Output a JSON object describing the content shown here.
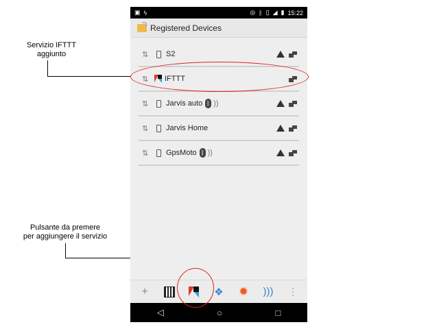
{
  "status_bar": {
    "time": "15:22",
    "left_icons": [
      "sim-icon",
      "charging-icon"
    ],
    "right_icons": [
      "nfc-icon",
      "bluetooth-icon",
      "vibrate-icon",
      "signal-icon",
      "battery-icon"
    ]
  },
  "app_bar": {
    "title": "Registered Devices"
  },
  "devices": [
    {
      "name": "S2",
      "has_bluetooth": false,
      "has_wave": false,
      "has_warning": true,
      "type": "phone"
    },
    {
      "name": "IFTTT",
      "has_bluetooth": false,
      "has_wave": false,
      "has_warning": false,
      "type": "ifttt"
    },
    {
      "name": "Jarvis auto",
      "has_bluetooth": true,
      "has_wave": true,
      "has_warning": true,
      "type": "phone"
    },
    {
      "name": "Jarvis Home",
      "has_bluetooth": false,
      "has_wave": false,
      "has_warning": true,
      "type": "phone"
    },
    {
      "name": "GpsMoto",
      "has_bluetooth": true,
      "has_wave": true,
      "has_warning": true,
      "type": "phone"
    }
  ],
  "toolbar": [
    "plus-icon",
    "qr-icon",
    "ifttt-icon",
    "dropbox-icon",
    "gear-icon",
    "wifi-icon",
    "more-icon"
  ],
  "nav": [
    "back-icon",
    "home-icon",
    "recents-icon"
  ],
  "annotations": {
    "ifttt_added": [
      "Servizio IFTTT",
      "aggiunto"
    ],
    "button_hint": [
      "Pulsante da premere",
      "per aggiungere il servizio"
    ]
  },
  "colors": {
    "highlight": "#e02020",
    "ifttt_red": "#e0382a",
    "ifttt_blue": "#29a3e0"
  }
}
